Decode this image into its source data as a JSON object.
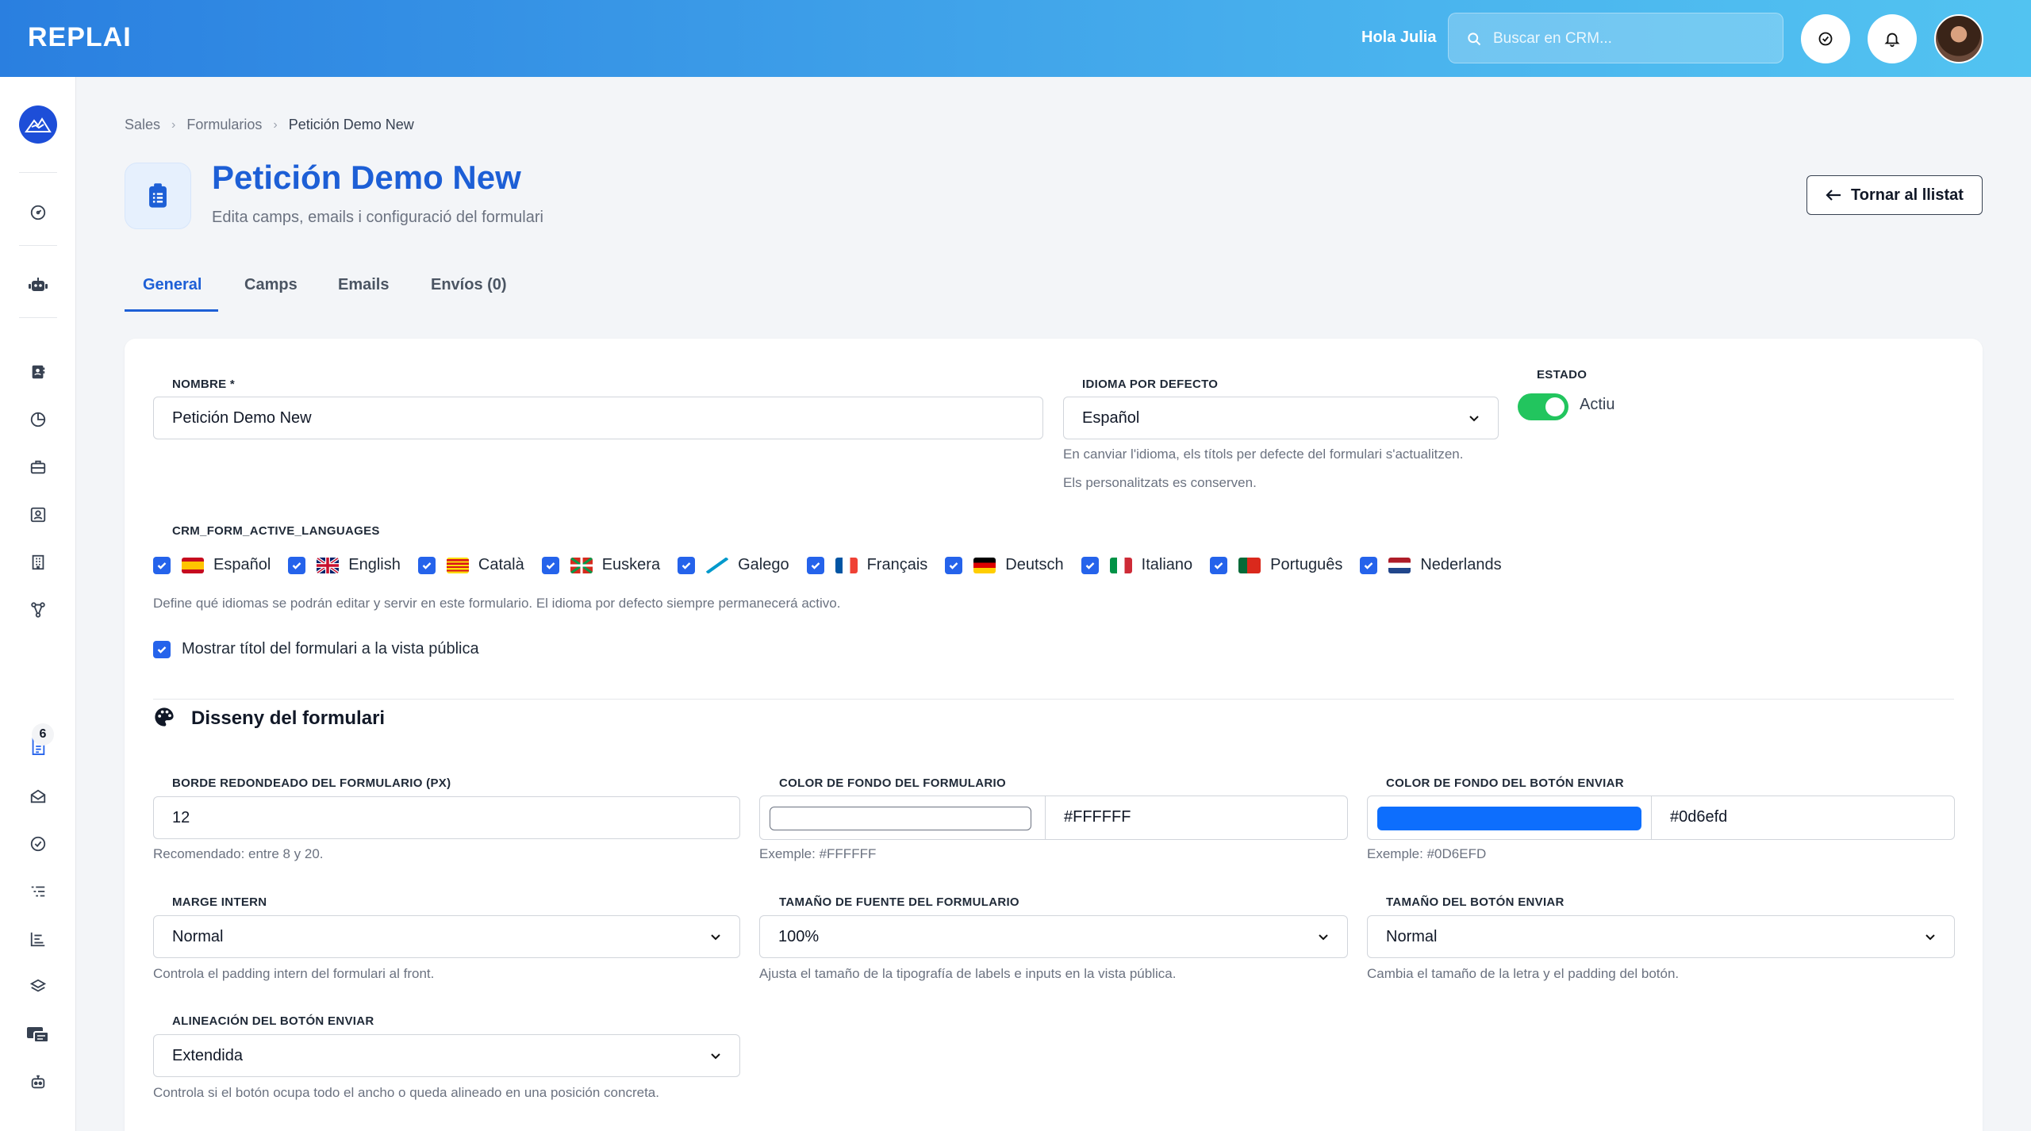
{
  "app": {
    "logo": "REPLAI",
    "greeting": "Hola Julia",
    "search_placeholder": "Buscar en CRM..."
  },
  "sidebar": {
    "badge": "6",
    "items": [
      "logo-icon",
      "dashboard-icon",
      "robot-icon",
      "contacts-book-icon",
      "pie-chart-icon",
      "briefcase-icon",
      "user-card-icon",
      "building-icon",
      "network-icon",
      "forms-icon",
      "mail-open-icon",
      "check-circle-icon",
      "list-icon",
      "bar-list-icon",
      "layers-icon",
      "campaigns-icon",
      "bot-icon"
    ]
  },
  "breadcrumb": {
    "item1": "Sales",
    "item2": "Formularios",
    "current": "Petición Demo New"
  },
  "header": {
    "title": "Petición Demo New",
    "subtitle": "Edita camps, emails i configuració del formulari",
    "back_button": "Tornar al llistat"
  },
  "tabs": [
    {
      "label": "General"
    },
    {
      "label": "Camps"
    },
    {
      "label": "Emails"
    },
    {
      "label": "Envíos (0)"
    }
  ],
  "general": {
    "nombre_label": "NOMBRE *",
    "nombre_value": "Petición Demo New",
    "idioma_label": "IDIOMA POR DEFECTO",
    "idioma_value": "Español",
    "idioma_help1": "En canviar l'idioma, els títols per defecte del formulari s'actualitzen.",
    "idioma_help2": "Els personalitzats es conserven.",
    "estado_label": "ESTADO",
    "estado_value": "Actiu",
    "languages_label": "CRM_FORM_ACTIVE_LANGUAGES",
    "languages": [
      {
        "name": "Español",
        "checked": true
      },
      {
        "name": "English",
        "checked": true
      },
      {
        "name": "Català",
        "checked": true
      },
      {
        "name": "Euskera",
        "checked": true
      },
      {
        "name": "Galego",
        "checked": true
      },
      {
        "name": "Français",
        "checked": true
      },
      {
        "name": "Deutsch",
        "checked": true
      },
      {
        "name": "Italiano",
        "checked": true
      },
      {
        "name": "Português",
        "checked": true
      },
      {
        "name": "Nederlands",
        "checked": true
      }
    ],
    "languages_help": "Define qué idiomas se podrán editar y servir en este formulario. El idioma por defecto siempre permanecerá activo.",
    "show_title_label": "Mostrar títol del formulari a la vista pública"
  },
  "design": {
    "title": "Disseny del formulari",
    "radius_label": "BORDE REDONDEADO DEL FORMULARIO (PX)",
    "radius_value": "12",
    "radius_help": "Recomendado: entre 8 y 20.",
    "bg_label": "COLOR DE FONDO DEL FORMULARIO",
    "bg_value": "#FFFFFF",
    "bg_help": "Exemple: #FFFFFF",
    "bg_color": "#FFFFFF",
    "btn_bg_label": "COLOR DE FONDO DEL BOTÓN ENVIAR",
    "btn_bg_value": "#0d6efd",
    "btn_bg_help": "Exemple: #0D6EFD",
    "btn_bg_color": "#0d6efd",
    "margin_label": "MARGE INTERN",
    "margin_value": "Normal",
    "margin_help": "Controla el padding intern del formulari al front.",
    "font_label": "TAMAÑO DE FUENTE DEL FORMULARIO",
    "font_value": "100%",
    "font_help": "Ajusta el tamaño de la tipografía de labels e inputs en la vista pública.",
    "btn_size_label": "TAMAÑO DEL BOTÓN ENVIAR",
    "btn_size_value": "Normal",
    "btn_size_help": "Cambia el tamaño de la letra y el padding del botón.",
    "align_label": "ALINEACIÓN DEL BOTÓN ENVIAR",
    "align_value": "Extendida",
    "align_help": "Controla si el botón ocupa todo el ancho o queda alineado en una posición concreta."
  }
}
